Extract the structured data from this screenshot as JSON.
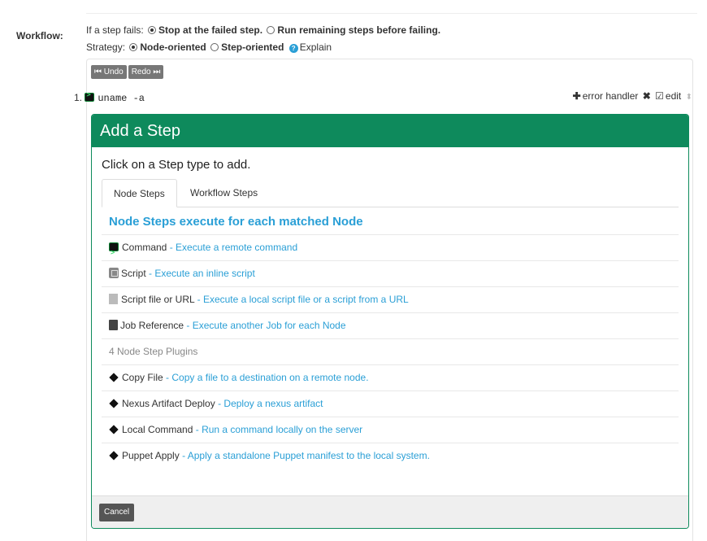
{
  "workflow": {
    "label": "Workflow:",
    "fail_prefix": "If a step fails:",
    "fail_options": [
      "Stop at the failed step.",
      "Run remaining steps before failing."
    ],
    "strategy_prefix": "Strategy:",
    "strategy_options": [
      "Node-oriented",
      "Step-oriented"
    ],
    "explain": "Explain"
  },
  "toolbar": {
    "undo": "Undo",
    "redo": "Redo"
  },
  "steps": [
    {
      "number": "1.",
      "command": "uname -a",
      "error_handler": "error handler",
      "edit": "edit"
    }
  ],
  "add_step": {
    "title": "Add a Step",
    "subtitle": "Click on a Step type to add.",
    "tabs": [
      "Node Steps",
      "Workflow Steps"
    ],
    "section_title": "Node Steps execute for each matched Node",
    "items": [
      {
        "name": "Command",
        "desc": "Execute a remote command",
        "icon": "terminal-icon"
      },
      {
        "name": "Script",
        "desc": "Execute an inline script",
        "icon": "script-icon"
      },
      {
        "name": "Script file or URL",
        "desc": "Execute a local script file or a script from a URL",
        "icon": "file-icon"
      },
      {
        "name": "Job Reference",
        "desc": "Execute another Job for each Node",
        "icon": "book-icon"
      }
    ],
    "plugins_header": "4 Node Step Plugins",
    "plugins": [
      {
        "name": "Copy File",
        "desc": "Copy a file to a destination on a remote node.",
        "icon": "diamond-icon"
      },
      {
        "name": "Nexus Artifact Deploy",
        "desc": "Deploy a nexus artifact",
        "icon": "diamond-icon"
      },
      {
        "name": "Local Command",
        "desc": "Run a command locally on the server",
        "icon": "diamond-icon"
      },
      {
        "name": "Puppet Apply",
        "desc": "Apply a standalone Puppet manifest to the local system.",
        "icon": "diamond-icon"
      }
    ],
    "cancel": "Cancel"
  },
  "colors": {
    "accent": "#0e8a5c",
    "link": "#2a9fd6"
  }
}
